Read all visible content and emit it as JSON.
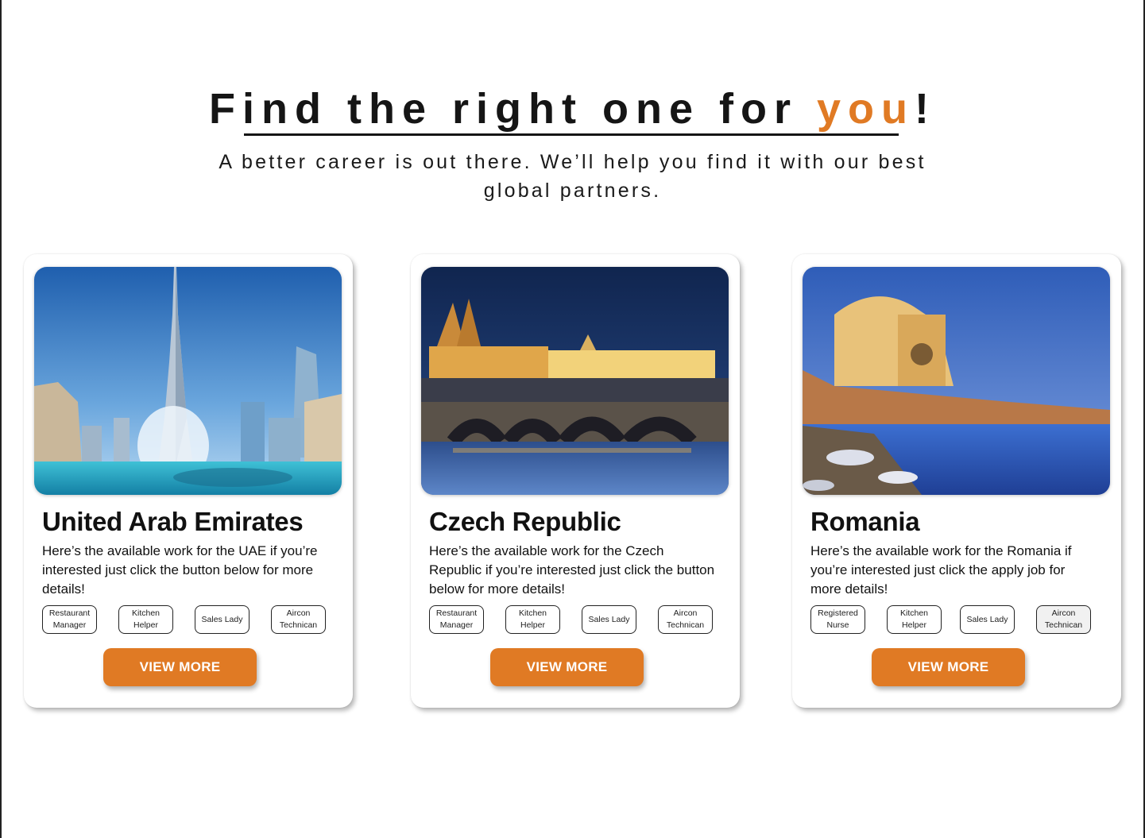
{
  "hero": {
    "title_main": "Find the right one for ",
    "title_accent": "you",
    "title_end": "!",
    "subtitle": "A better career is out there. We’ll help you find it with our best global partners."
  },
  "colors": {
    "accent": "#e07a24",
    "text": "#151515"
  },
  "cards": [
    {
      "image": "dubai-skyline-fountain",
      "title": "United Arab Emirates",
      "description": "Here’s the available work for the UAE if you’re interested just click the button below for more details!",
      "tags": [
        "Restaurant Manager",
        "Kitchen Helper",
        "Sales Lady",
        "Aircon Technican"
      ],
      "button": "VIEW MORE"
    },
    {
      "image": "prague-charles-bridge-night",
      "title": "Czech Republic",
      "description": "Here’s the available work for the Czech Republic if you’re interested just click the button below for more details!",
      "tags": [
        "Restaurant Manager",
        "Kitchen Helper",
        "Sales Lady",
        "Aircon Technican"
      ],
      "button": "VIEW MORE"
    },
    {
      "image": "constanta-casino-sea",
      "title": "Romania",
      "description": "Here’s the available work for the Romania if you’re interested just click the apply job for more details!",
      "tags": [
        "Registered Nurse",
        "Kitchen Helper",
        "Sales Lady",
        "Aircon Technican"
      ],
      "button": "VIEW MORE"
    }
  ]
}
